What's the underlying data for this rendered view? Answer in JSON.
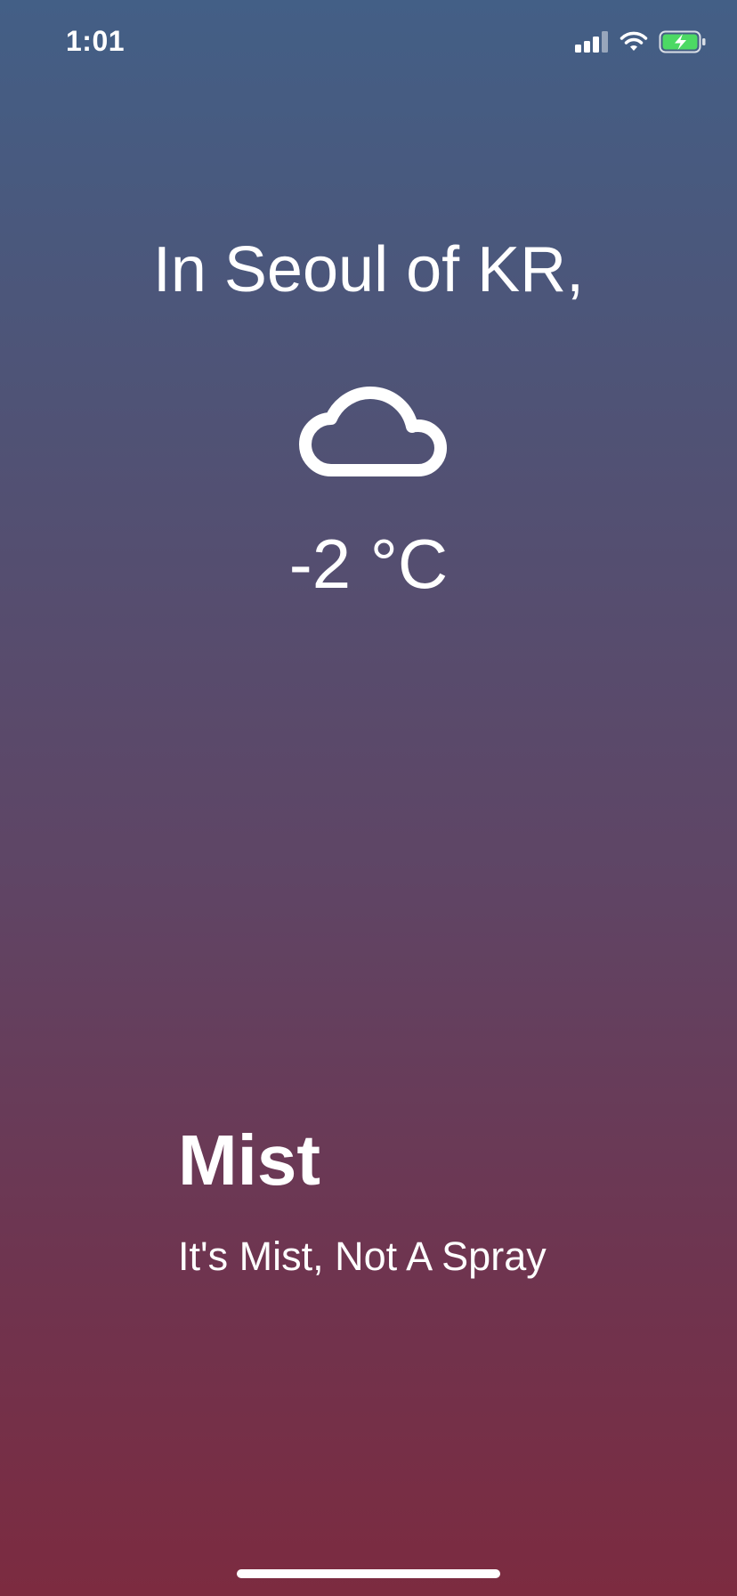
{
  "status_bar": {
    "time": "1:01",
    "icons": [
      "cellular-signal-icon",
      "wifi-icon",
      "battery-charging-icon"
    ],
    "battery_color": "#4cd964"
  },
  "weather": {
    "location_text": "In Seoul of KR,",
    "icon": "cloud-icon",
    "temperature": "-2 °C",
    "condition": "Mist",
    "subtitle": "It's Mist, Not A Spray"
  },
  "colors": {
    "gradient_top": "#435f86",
    "gradient_bottom": "#7c2b40",
    "text": "#ffffff"
  }
}
